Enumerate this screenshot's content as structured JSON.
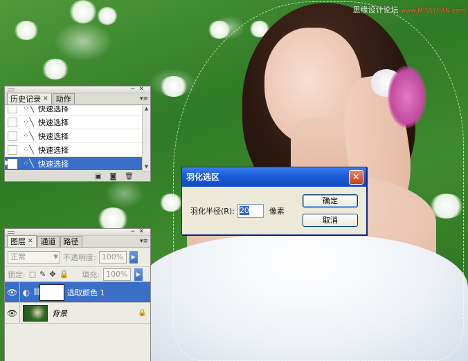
{
  "watermark": {
    "text": "思缘设计论坛",
    "site": "www.MISSYUAN.com"
  },
  "history_panel": {
    "tabs": [
      {
        "label": "历史记录"
      },
      {
        "label": "动作"
      }
    ],
    "items": [
      {
        "label": "快速选择",
        "selected": false
      },
      {
        "label": "快速选择",
        "selected": false
      },
      {
        "label": "快速选择",
        "selected": false
      },
      {
        "label": "快速选择",
        "selected": false
      },
      {
        "label": "快速选择",
        "selected": true
      }
    ]
  },
  "feather_dialog": {
    "title": "羽化选区",
    "radius_label": "羽化半径(R):",
    "radius_value": "20",
    "unit": "像素",
    "ok_label": "确定",
    "cancel_label": "取消"
  },
  "layers_panel": {
    "tabs": [
      {
        "label": "图层"
      },
      {
        "label": "通道"
      },
      {
        "label": "路径"
      }
    ],
    "blend_mode": "正常",
    "opacity_label": "不透明度:",
    "opacity_value": "100%",
    "lock_label": "锁定:",
    "fill_label": "填充:",
    "fill_value": "100%",
    "layers": [
      {
        "name": "选取颜色 1",
        "selected": true
      },
      {
        "name": "背景",
        "selected": false
      }
    ]
  },
  "colors": {
    "selection_blue": "#3a6fc7",
    "xp_title": "#1b5ed8",
    "close_red": "#c8401c"
  }
}
